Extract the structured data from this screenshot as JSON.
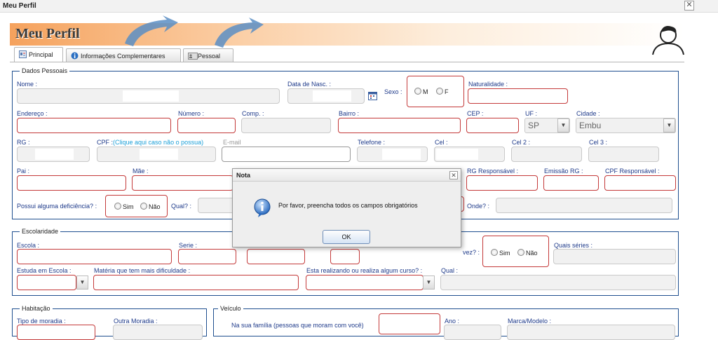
{
  "window": {
    "title": "Meu Perfil"
  },
  "page": {
    "title": "Meu Perfil"
  },
  "tabs": [
    {
      "label": "Principal"
    },
    {
      "label": "Informações Complementares"
    },
    {
      "label": "Pessoal"
    }
  ],
  "dados": {
    "legend": "Dados Pessoais",
    "nome": "Nome :",
    "data_nasc": "Data de Nasc. :",
    "sexo": "Sexo :",
    "sexo_m": "M",
    "sexo_f": "F",
    "naturalidade": "Naturalidade :",
    "endereco": "Endereço :",
    "numero": "Número :",
    "comp": "Comp. :",
    "bairro": "Bairro :",
    "cep": "CEP :",
    "uf": "UF :",
    "uf_value": "SP",
    "cidade": "Cidade :",
    "cidade_value": "Embu",
    "rg": "RG :",
    "cpf": "CPF :",
    "cpf_link": "(Clique aqui caso não o possua)",
    "email_placeholder": "E-mail",
    "telefone": "Telefone :",
    "cel": "Cel :",
    "cel2": "Cel 2 :",
    "cel3": "Cel 3 :",
    "pai": "Pai :",
    "mae": "Mãe :",
    "rg_resp": "RG Responsável :",
    "emissao_rg": "Emissão RG :",
    "cpf_resp": "CPF Responsável :",
    "deficiencia": "Possui alguma deficiência? :",
    "sim": "Sim",
    "nao": "Não",
    "qual": "Qual? :",
    "onde": "Onde? :"
  },
  "escolaridade": {
    "legend": "Escolaridade",
    "escola": "Escola :",
    "serie": "Serie :",
    "vez": "vez? :",
    "sim": "Sim",
    "nao": "Não",
    "quais_series": "Quais séries :",
    "estuda_em_escola": "Estuda em Escola :",
    "materia": "Matéria que tem mais dificuldade :",
    "curso": "Esta realizando ou realiza algum curso? :",
    "qual": "Qual :"
  },
  "habitacao": {
    "legend": "Habitação",
    "tipo_moradia": "Tipo de moradia :",
    "outra_moradia": "Outra Moradia :"
  },
  "veiculo": {
    "legend": "Veículo",
    "familia": "Na sua família (pessoas que moram com você)",
    "ano": "Ano :",
    "marca_modelo": "Marca/Modelo :"
  },
  "dialog": {
    "title": "Nota",
    "message": "Por favor, preencha todos os campos obrigatórios",
    "ok": "OK"
  },
  "icons": [
    "close-icon",
    "profile-tab-icon",
    "info-icon",
    "person-card-icon",
    "calendar-icon",
    "user-avatar-icon",
    "arrow-icon",
    "chevron-down-icon"
  ],
  "colors": {
    "banner_accent": "#f5a25d",
    "required_border": "#c43a3a",
    "fieldset_border": "#1f4f8f",
    "label": "#1e3a8a",
    "arrow": "#5b8ec4"
  }
}
